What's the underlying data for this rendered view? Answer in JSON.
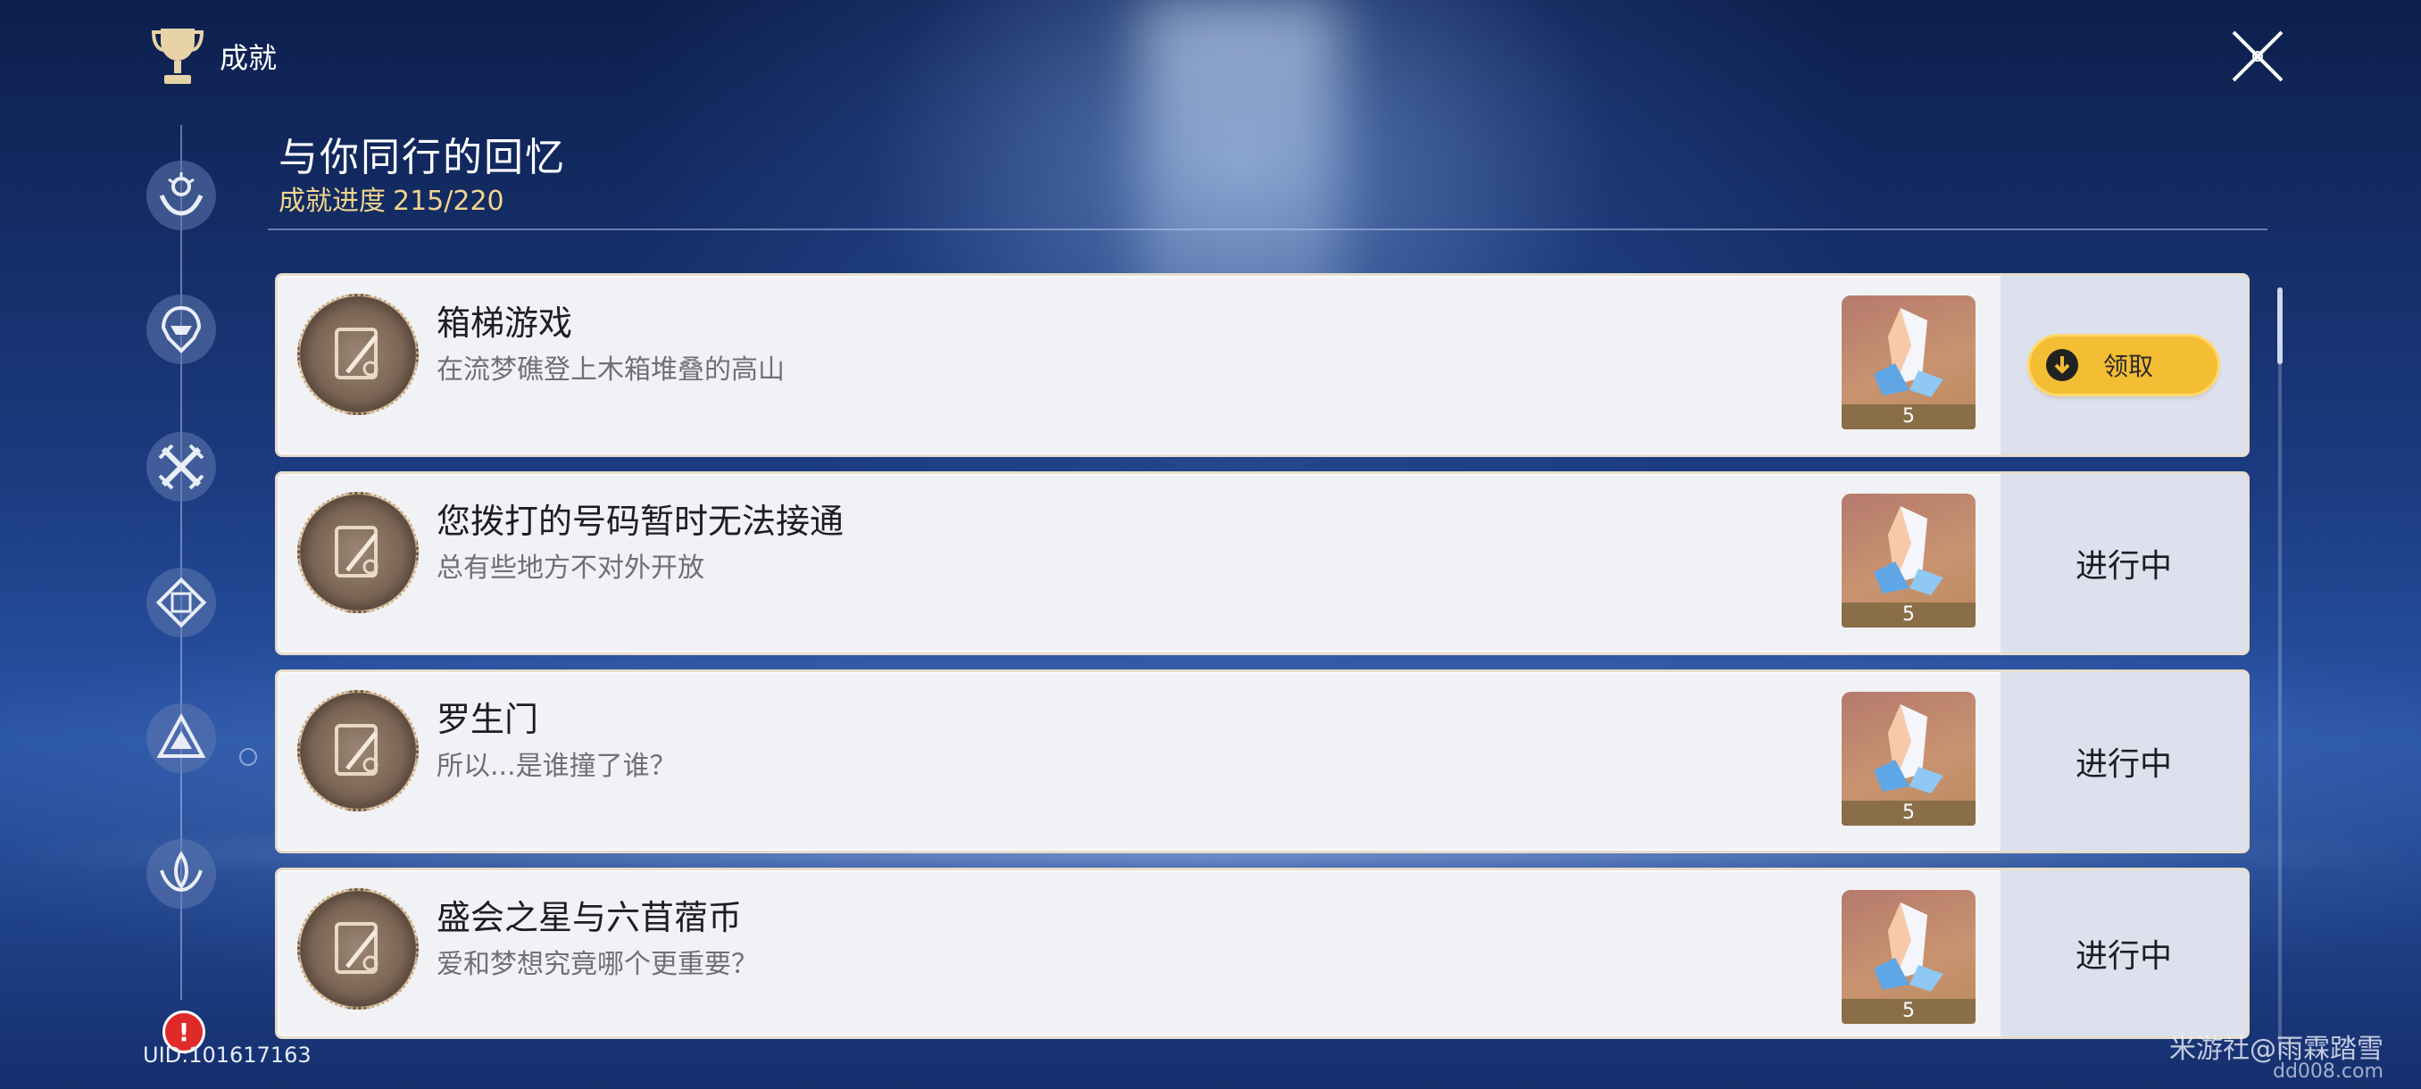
{
  "header": {
    "title": "成就",
    "icon": "trophy-icon"
  },
  "sidebar": {
    "items": [
      {
        "icon": "hand-emblem-icon"
      },
      {
        "icon": "helmet-emblem-icon"
      },
      {
        "icon": "crossed-swords-icon"
      },
      {
        "icon": "diamond-emblem-icon"
      },
      {
        "icon": "triangle-emblem-icon"
      },
      {
        "icon": "lotus-emblem-icon"
      }
    ]
  },
  "section": {
    "title": "与你同行的回忆",
    "progress_label": "成就进度",
    "progress_value": "215/220"
  },
  "achievements": [
    {
      "title": "箱梯游戏",
      "desc": "在流梦礁登上木箱堆叠的高山",
      "reward_count": "5",
      "status": "",
      "claim_label": "领取"
    },
    {
      "title": "您拨打的号码暂时无法接通",
      "desc": "总有些地方不对外开放",
      "reward_count": "5",
      "status": "进行中"
    },
    {
      "title": "罗生门",
      "desc": "所以...是谁撞了谁？",
      "reward_count": "5",
      "status": "进行中"
    },
    {
      "title": "盛会之星与六苜蓿币",
      "desc": "爱和梦想究竟哪个更重要？",
      "reward_count": "5",
      "status": "进行中"
    }
  ],
  "footer": {
    "uid": "UID:101617163",
    "watermark": "米游社@雨霖踏雪",
    "site": "dd008.com"
  },
  "colors": {
    "accent_gold": "#f3bd34",
    "progress_text": "#f1d58d",
    "card_bg": "#f1f2f6",
    "status_bg": "#dde1ee"
  }
}
